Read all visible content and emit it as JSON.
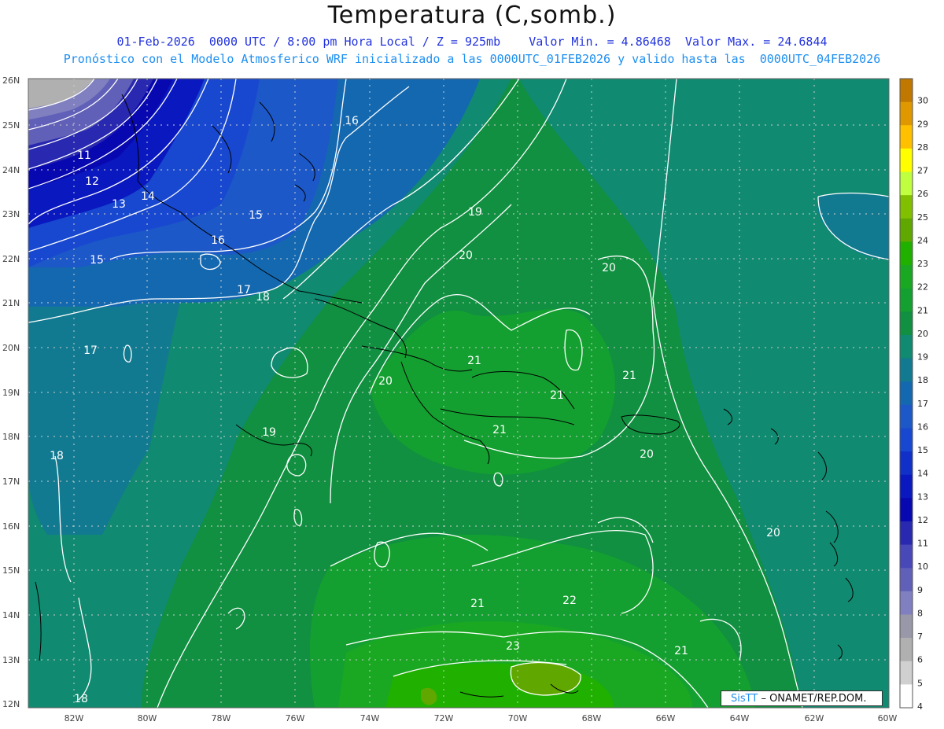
{
  "header": {
    "title": "Temperatura (C,somb.)",
    "subtitle1": "01-Feb-2026  0000 UTC / 8:00 pm Hora Local / Z = 925mb    Valor Min. = 4.86468  Valor Max. = 24.6844",
    "subtitle2": "Pronóstico con el Modelo Atmosferico WRF inicializado a las 0000UTC_01FEB2026 y valido hasta las  0000UTC_04FEB2026"
  },
  "axes": {
    "lat_labels": [
      "26N",
      "25N",
      "24N",
      "23N",
      "22N",
      "21N",
      "20N",
      "19N",
      "18N",
      "17N",
      "16N",
      "15N",
      "14N",
      "13N",
      "12N"
    ],
    "lon_labels": [
      "82W",
      "80W",
      "78W",
      "76W",
      "74W",
      "72W",
      "70W",
      "68W",
      "66W",
      "64W",
      "62W",
      "60W"
    ]
  },
  "colorbar": {
    "labels": [
      "30",
      "29",
      "28",
      "27",
      "26",
      "25",
      "24",
      "23",
      "22",
      "21",
      "20",
      "19",
      "18",
      "17",
      "16",
      "15",
      "14",
      "13",
      "12",
      "11",
      "10",
      "9",
      "8",
      "7",
      "6",
      "5",
      "4"
    ],
    "colors": [
      "#c07800",
      "#e09800",
      "#ffc000",
      "#ffff00",
      "#c0ff40",
      "#80c000",
      "#60a800",
      "#20b000",
      "#1aa822",
      "#14a030",
      "#109040",
      "#108a70",
      "#127a90",
      "#1468b0",
      "#1c58c8",
      "#1848d0",
      "#1030c8",
      "#0a18c0",
      "#0808b0",
      "#2828b0",
      "#4848b8",
      "#6060b8",
      "#8080c0",
      "#9898a8",
      "#b0b0b0",
      "#d0d0d0",
      "#ffffff"
    ]
  },
  "contour_labels": [
    {
      "text": "16"
    },
    {
      "text": "11"
    },
    {
      "text": "12"
    },
    {
      "text": "13"
    },
    {
      "text": "14"
    },
    {
      "text": "15"
    },
    {
      "text": "15"
    },
    {
      "text": "16"
    },
    {
      "text": "17"
    },
    {
      "text": "18"
    },
    {
      "text": "19"
    },
    {
      "text": "20"
    },
    {
      "text": "20"
    },
    {
      "text": "17"
    },
    {
      "text": "20"
    },
    {
      "text": "21"
    },
    {
      "text": "21"
    },
    {
      "text": "21"
    },
    {
      "text": "21"
    },
    {
      "text": "19"
    },
    {
      "text": "18"
    },
    {
      "text": "20"
    },
    {
      "text": "20"
    },
    {
      "text": "21"
    },
    {
      "text": "22"
    },
    {
      "text": "23"
    },
    {
      "text": "21"
    },
    {
      "text": "18"
    }
  ],
  "credit": {
    "part1": "SisTT",
    "part2": "– ONAMET/REP.DOM."
  }
}
